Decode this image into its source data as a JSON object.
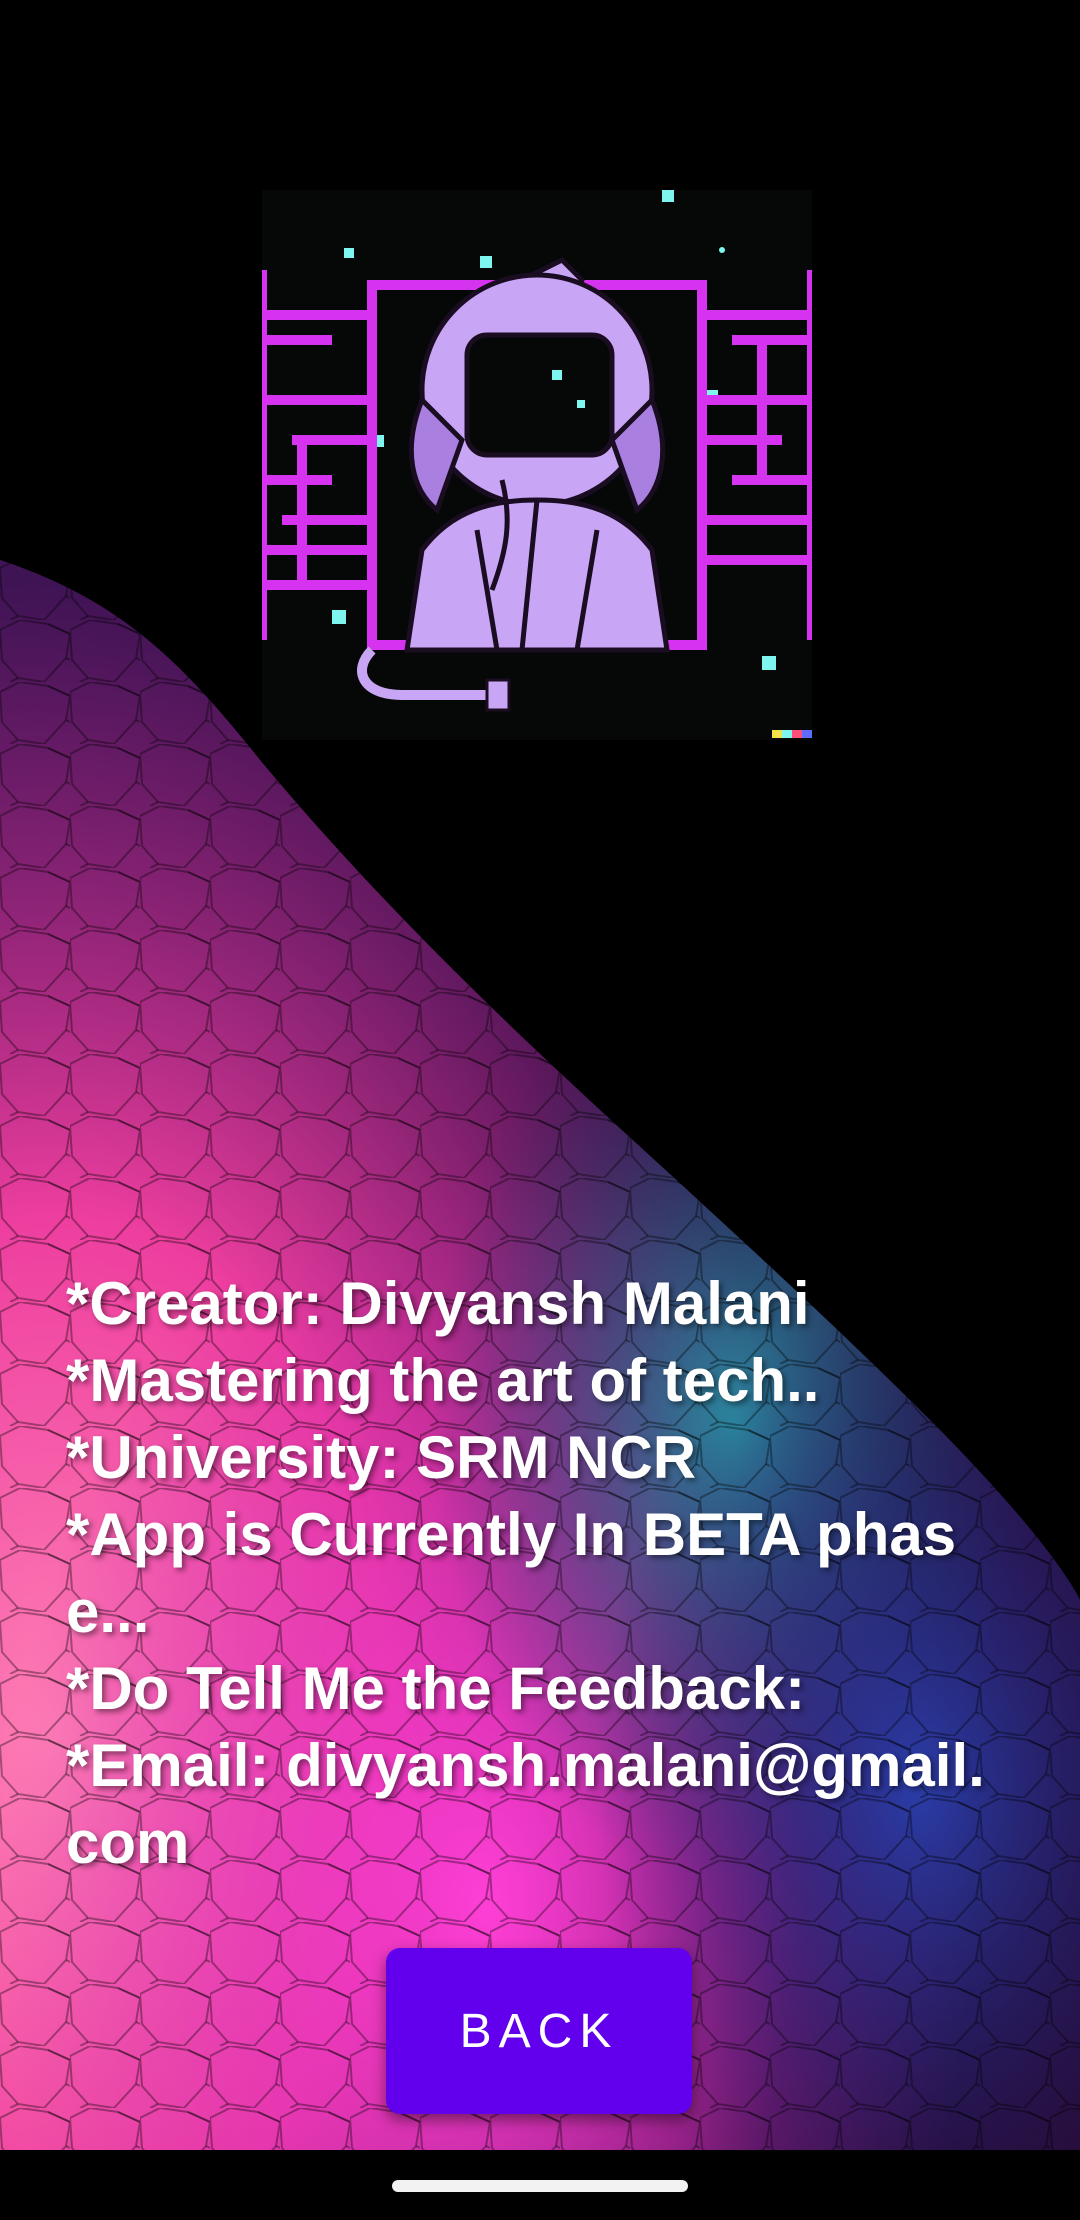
{
  "about": {
    "lines": [
      "*Creator: Divyansh Malani",
      "*Mastering the art of tech..",
      "*University: SRM NCR",
      "*App is Currently In BETA phase...",
      "*Do Tell Me the Feedback:",
      "*Email: divyansh.malani@gmail.com"
    ]
  },
  "back_button": {
    "label": "BACK"
  },
  "colors": {
    "button": "#6200ee",
    "text": "#ffffff",
    "background": "#000000",
    "avatar_accent": "#d633f0",
    "avatar_figure": "#c9a6f5",
    "avatar_stars": "#7ff5f0"
  },
  "avatar": {
    "icon": "astronaut-icon"
  }
}
